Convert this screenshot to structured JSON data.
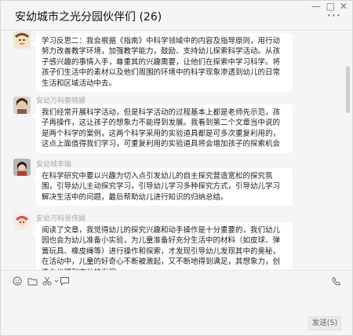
{
  "window": {
    "title": "安幼城市之光分园伙伴们 (26)"
  },
  "messages": [
    {
      "sender": "",
      "avatar": "cartoon-avatar",
      "text": "学习反思二：我会根据《指南》中科学领域中的内容及指导原则，用行动努力改善教学环境，加强教学能力，鼓励、支持幼儿探索科学活动。从孩子感兴趣的事情入手，尊重其的兴趣需要，让他们在探索中学习科学。将孩子们生活中的素材以及他们周围的环境中的科学现象渗透到幼儿的日常生活和区域活动中去。"
    },
    {
      "sender": "安幼万科蔡晓娜",
      "avatar": "woman-photo-avatar",
      "text": "我们经常开展科学活动，但是科学活动的过程基本上都是老师先示范，孩子再操作，这让孩子的想象力不能得到发展。我看到第二个文章当中说的是两个科学的案例，这两个科学采用的实验道具都是可多次重复利用的，这点上面值得我们学习，可重复利用的实验道具将会增加孩子的探索机会"
    },
    {
      "sender": "安幼城李瑜",
      "avatar": "girl-photo-avatar",
      "text": "在科学研究中要以兴趣为切入点引发幼儿的自主探究营造宽松的探究氛围，引导幼儿主动探究学习，引导幼儿学习多种探究方式，引导幼儿学习解决生活中的问题，最后帮助幼儿进行知识的归纳总结。"
    },
    {
      "sender": "安幼万科张伟娟",
      "avatar": "cartoon-avatar-2",
      "text": "阅读了文章，我觉得幼儿的探究兴趣和动手操作是十分重要的，我们幼儿园也会为幼儿准备小实验，为儿童准备好充分生活中的材料（如皮球、弹簧玩具、橡皮绳等）进行操作和探索，才发现引导幼儿发现其中的奥秘，在活动中，儿童的好奇心不断被激起，又不断地得到满足，其想象力，创造力也得到充分的发挥。"
    }
  ],
  "toolbar": {
    "icons": [
      "emoji-icon",
      "folder-icon",
      "scissors-icon",
      "chat-record-icon",
      "video-call-icon"
    ]
  },
  "composer": {
    "send_label": "发送(S)"
  }
}
